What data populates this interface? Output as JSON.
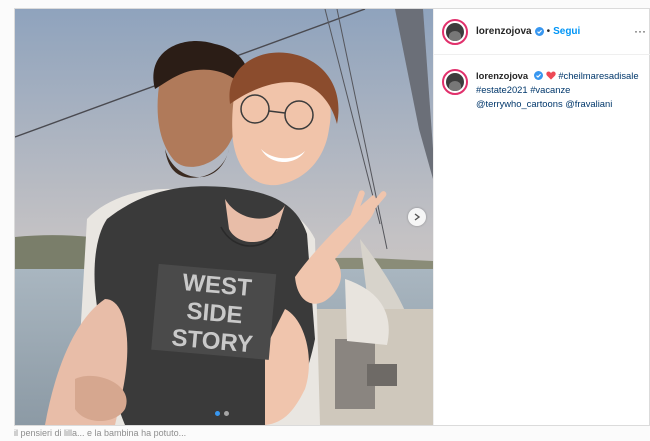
{
  "post": {
    "username": "lorenzojova",
    "follow_label": "Segui",
    "separator": "•",
    "more_label": "···",
    "caption": {
      "username": "lorenzojova",
      "hashtags_line1": "#cheilmaresadisale",
      "hashtags_line2": [
        "#estate2021",
        "#vacanze"
      ],
      "mentions": [
        "@terrywho_cartoons",
        "@fravaliani"
      ]
    },
    "shirt_text": [
      "WEST",
      "SIDE",
      "STORY"
    ]
  },
  "bottom_snippet": "il pensieri di lilla... e la bambina ha potuto...",
  "colors": {
    "accent": "#0095f6",
    "heart": "#ed4956",
    "story_ring": "#e1306c"
  },
  "icons": [
    "verified-badge-icon",
    "heart-emoji-icon",
    "more-options-icon",
    "chevron-right-icon"
  ]
}
